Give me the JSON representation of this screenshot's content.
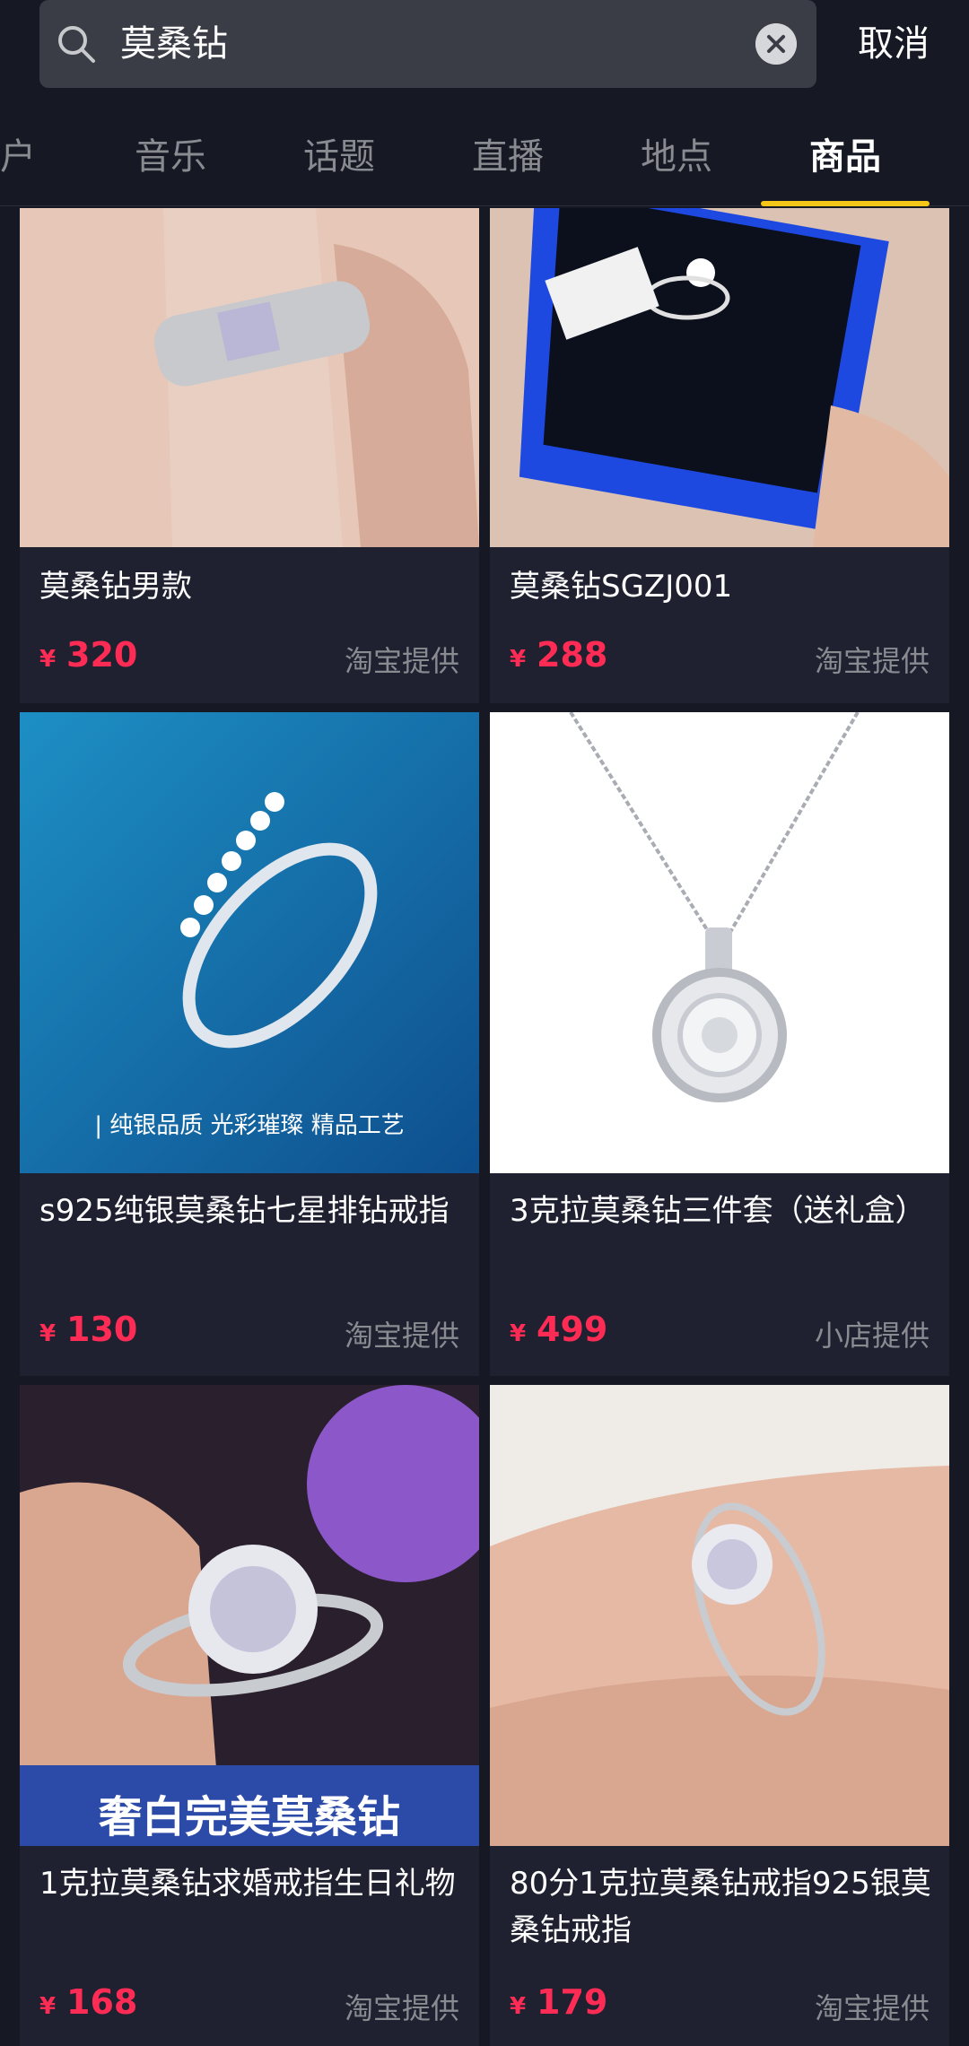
{
  "search": {
    "query": "莫桑钻",
    "cancel_label": "取消"
  },
  "tabs": [
    {
      "label": "户"
    },
    {
      "label": "音乐"
    },
    {
      "label": "话题"
    },
    {
      "label": "直播"
    },
    {
      "label": "地点"
    },
    {
      "label": "商品"
    }
  ],
  "active_tab": "商品",
  "products": [
    {
      "title": "莫桑钻男款",
      "currency": "¥",
      "price": "320",
      "provider": "淘宝提供"
    },
    {
      "title": "莫桑钻SGZJ001",
      "currency": "¥",
      "price": "288",
      "provider": "淘宝提供"
    },
    {
      "title": "s925纯银莫桑钻七星排钻戒指",
      "currency": "¥",
      "price": "130",
      "provider": "淘宝提供",
      "image_caption": "| 纯银品质  光彩璀璨  精品工艺"
    },
    {
      "title": "3克拉莫桑钻三件套（送礼盒）",
      "currency": "¥",
      "price": "499",
      "provider": "小店提供"
    },
    {
      "title": "1克拉莫桑钻求婚戒指生日礼物",
      "currency": "¥",
      "price": "168",
      "provider": "淘宝提供",
      "image_banner": "奢白完美莫桑钻"
    },
    {
      "title": "80分1克拉莫桑钻戒指925银莫桑钻戒指",
      "currency": "¥",
      "price": "179",
      "provider": "淘宝提供"
    }
  ],
  "colors": {
    "background": "#161823",
    "card": "#1f2130",
    "price": "#fe2c55",
    "tab_indicator": "#f5c518"
  }
}
